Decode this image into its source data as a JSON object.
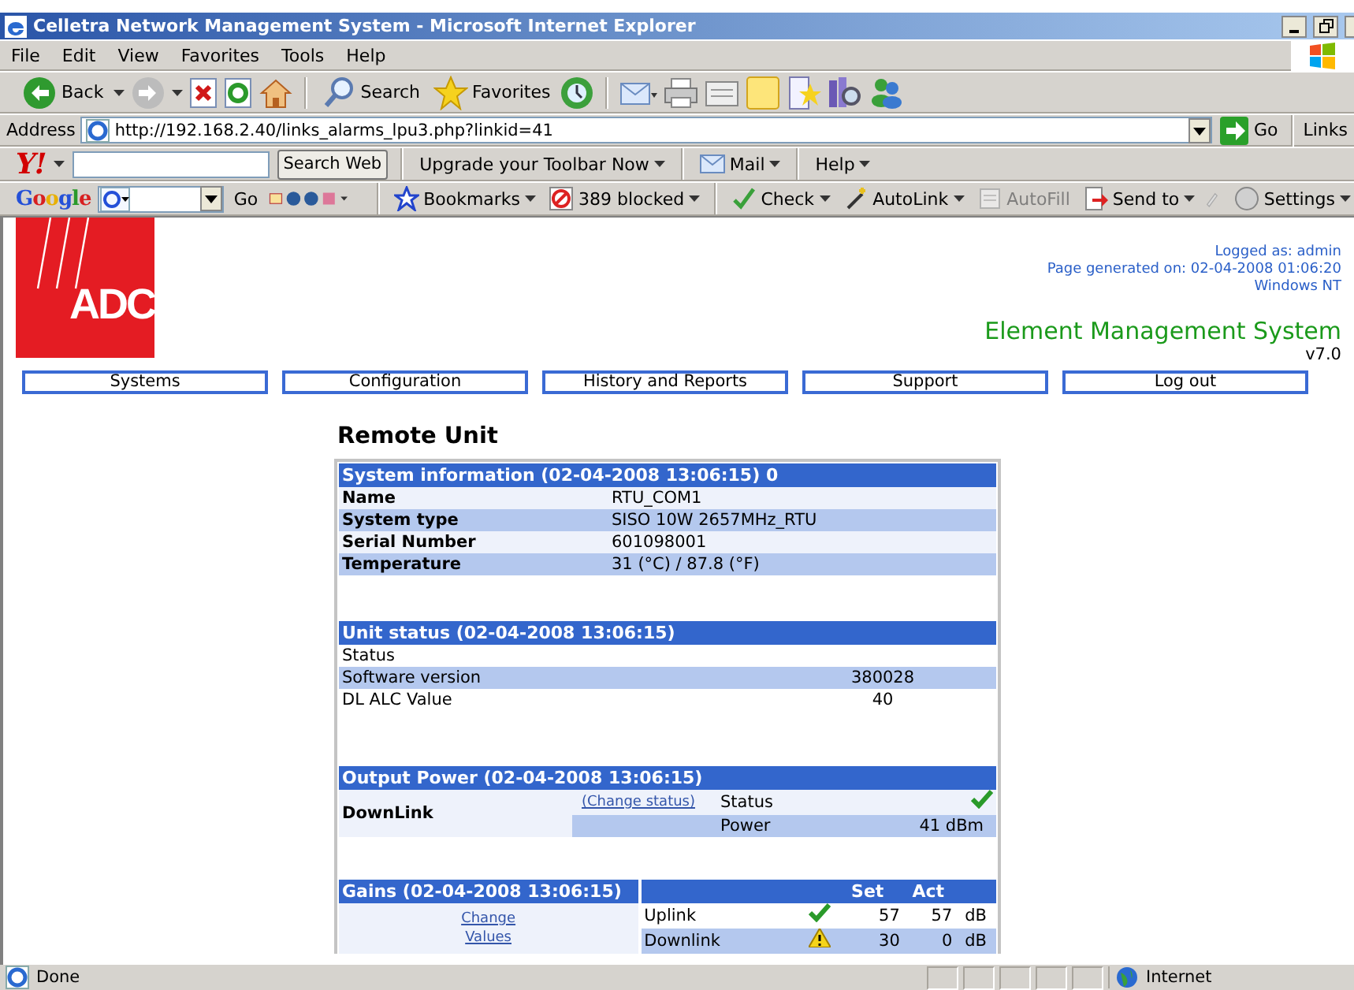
{
  "window": {
    "title": "Celletra Network Management System - Microsoft Internet Explorer"
  },
  "menu": [
    "File",
    "Edit",
    "View",
    "Favorites",
    "Tools",
    "Help"
  ],
  "toolbar": {
    "back": "Back",
    "search": "Search",
    "favorites": "Favorites"
  },
  "address_bar": {
    "label": "Address",
    "url": "http://192.168.2.40/links_alarms_lpu3.php?linkid=41",
    "go": "Go",
    "links": "Links"
  },
  "yahoo_toolbar": {
    "logo": "Y!",
    "search_button": "Search Web",
    "items": [
      {
        "label": "Upgrade your Toolbar Now",
        "kind": "plain"
      },
      {
        "label": "Mail",
        "kind": "mail"
      },
      {
        "label": "Help",
        "kind": "plain"
      }
    ]
  },
  "google_toolbar": {
    "logo": "Google",
    "go": "Go",
    "items": [
      {
        "label": "Bookmarks",
        "kind": "bookmarks",
        "disabled": false
      },
      {
        "label": "389 blocked",
        "kind": "blocker",
        "disabled": false
      },
      {
        "label": "Check",
        "kind": "spellcheck",
        "disabled": false
      },
      {
        "label": "AutoLink",
        "kind": "autolink",
        "disabled": false
      },
      {
        "label": "AutoFill",
        "kind": "autofill",
        "disabled": true
      },
      {
        "label": "Send to",
        "kind": "sendto",
        "disabled": false
      }
    ],
    "settings": "Settings"
  },
  "page": {
    "logo": "ADC",
    "logged_as": "Logged as: admin",
    "generated": "Page generated on: 02-04-2008 01:06:20",
    "os": "Windows NT",
    "app_title": "Element Management System",
    "version": "v7.0",
    "nav": [
      "Systems",
      "Configuration",
      "History and Reports",
      "Support",
      "Log out"
    ],
    "heading": "Remote Unit",
    "system_info": {
      "title": "System information (02-04-2008 13:06:15) 0",
      "rows": [
        {
          "label": "Name",
          "value": "RTU_COM1"
        },
        {
          "label": "System type",
          "value": "SISO 10W 2657MHz_RTU"
        },
        {
          "label": "Serial Number",
          "value": "601098001"
        },
        {
          "label": "Temperature",
          "value": "31 (°C) / 87.8 (°F)"
        }
      ]
    },
    "unit_status": {
      "title": "Unit status (02-04-2008 13:06:15)",
      "rows": [
        {
          "label": "Status"
        },
        {
          "label": "Software version",
          "value": "380028"
        },
        {
          "label": "DL ALC Value",
          "value": "40"
        }
      ]
    },
    "output_power": {
      "title": "Output Power (02-04-2008 13:06:15)",
      "link_label": "DownLink",
      "link": "(Change status)",
      "status_label": "Status",
      "warning": false,
      "power_label": "Power",
      "power": "41 dBm"
    },
    "gains": {
      "title": "Gains (02-04-2008 13:06:15)",
      "columns": [
        "Set",
        "Act"
      ],
      "link": "Change Values",
      "rows": [
        {
          "label": "Uplink",
          "warning": false,
          "set": "57",
          "act": "57",
          "unit": "dB"
        },
        {
          "label": "Downlink",
          "warning": true,
          "set": "30",
          "act": "0",
          "unit": "dB"
        }
      ]
    }
  },
  "status_bar": {
    "text": "Done",
    "zone": "Internet"
  }
}
